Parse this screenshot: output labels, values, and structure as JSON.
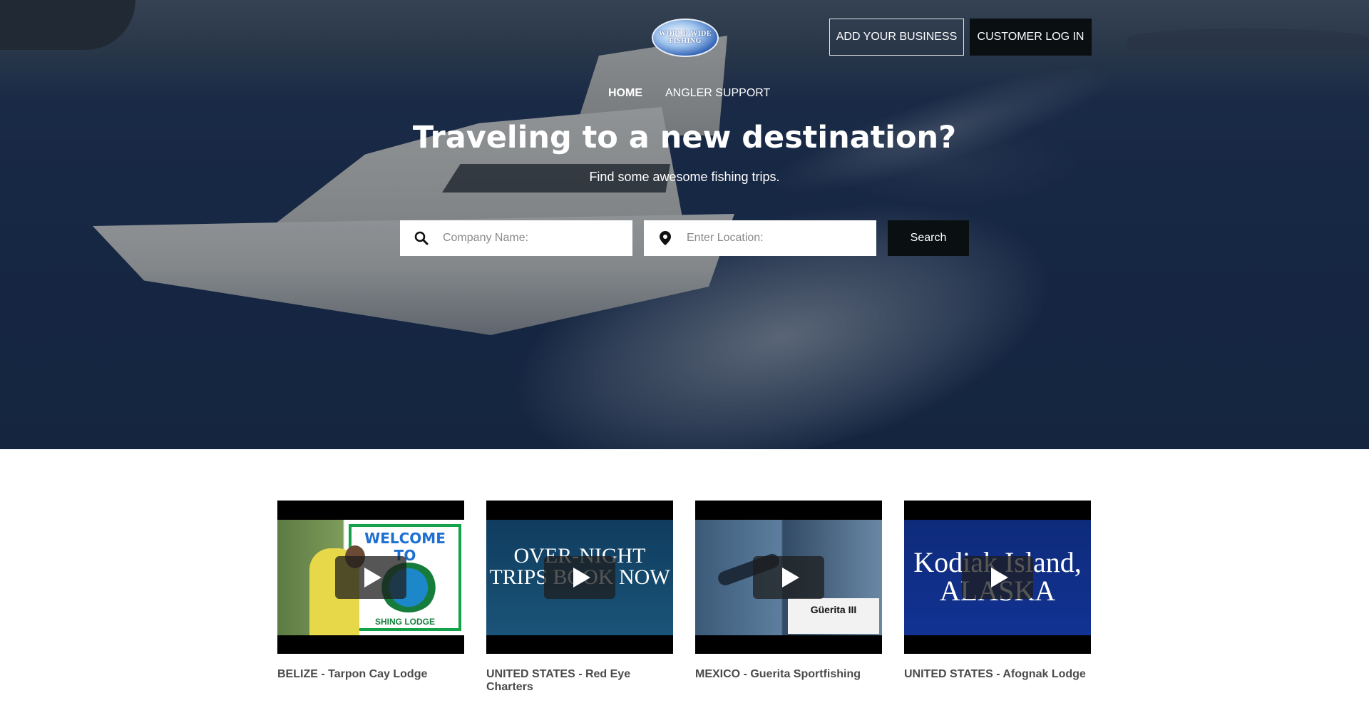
{
  "header": {
    "logo_text": "WORLD WIDE FISHING",
    "add_business_label": "ADD YOUR BUSINESS",
    "login_label": "CUSTOMER LOG IN"
  },
  "nav": {
    "items": [
      {
        "label": "HOME",
        "active": true
      },
      {
        "label": "ANGLER SUPPORT",
        "active": false
      }
    ]
  },
  "hero": {
    "headline": "Traveling to a new destination?",
    "subline": "Find some awesome fishing trips."
  },
  "search": {
    "company_placeholder": "Company Name:",
    "location_placeholder": "Enter Location:",
    "button_label": "Search",
    "search_icon": "search-icon",
    "location_icon": "map-pin-icon"
  },
  "videos": [
    {
      "caption": "BELIZE - Tarpon Cay Lodge",
      "thumb_text": "WELCOME TO",
      "thumb_sub": "SHING LODGE"
    },
    {
      "caption": "UNITED STATES - Red Eye Charters",
      "thumb_text": "OVER-NIGHT TRIPS BOOK NOW"
    },
    {
      "caption": "MEXICO - Guerita Sportfishing",
      "thumb_text": "Güerita III"
    },
    {
      "caption": "UNITED STATES - Afognak Lodge",
      "thumb_text": "Kodiak Island, ALASKA"
    }
  ],
  "colors": {
    "button_dark": "#0a0f12",
    "caption": "#4a4a4a"
  }
}
